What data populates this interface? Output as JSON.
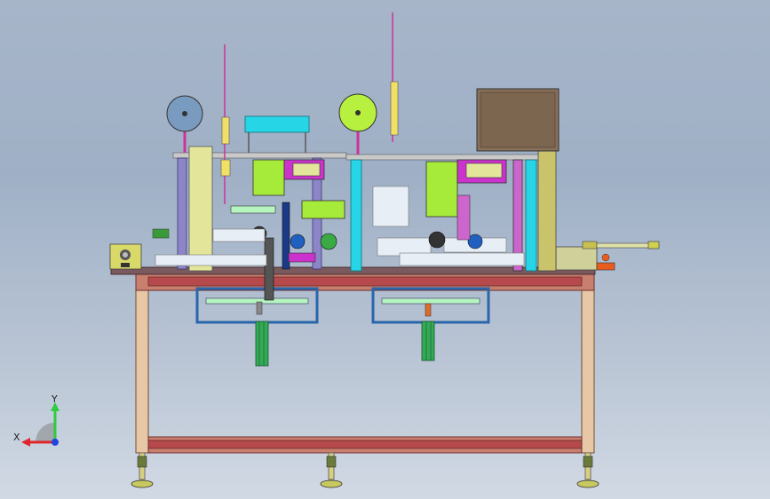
{
  "view": {
    "axes": {
      "x_label": "X",
      "y_label": "Y"
    },
    "colors": {
      "background_top": "#a7b5c9",
      "background_bottom": "#d1d9e4",
      "frame_wood": "#e8c7a6",
      "rail_red": "#b5494b",
      "column_lavender": "#8c86c9",
      "cyan": "#26d6e6",
      "lime": "#a6ea3a",
      "magenta": "#cc33cc",
      "plate_yellow": "#e3e69a",
      "olive": "#c9c36b",
      "brown_box": "#87705a",
      "axis_x": "#e0262b",
      "axis_y": "#2ecc40",
      "axis_z": "#2244dd"
    }
  }
}
